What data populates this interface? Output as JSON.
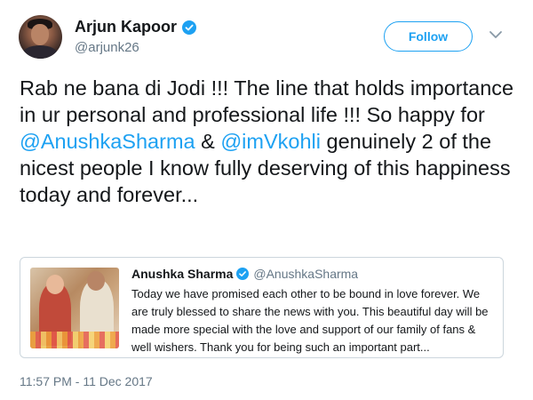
{
  "author": {
    "name": "Arjun Kapoor",
    "handle": "@arjunk26",
    "verified": true
  },
  "follow_button_label": "Follow",
  "tweet_text": {
    "part1": "Rab ne bana di Jodi !!! The line that holds importance in ur personal and professional life !!! So happy for ",
    "mention1": "@AnushkaSharma",
    "part2": " & ",
    "mention2": "@imVkohli",
    "part3": " genuinely 2 of the nicest people I know fully deserving of this happiness today and forever..."
  },
  "quoted_tweet": {
    "name": "Anushka Sharma",
    "handle": "@AnushkaSharma",
    "verified": true,
    "text": "Today we have promised each other to be bound in love forever. We are truly blessed to share the news with you. This beautiful day will be made more special with the love and support of our family of fans & well wishers. Thank you for being such an important part..."
  },
  "timestamp": "11:57 PM - 11 Dec 2017",
  "colors": {
    "accent": "#1da1f2",
    "text": "#14171a",
    "muted": "#657786",
    "border": "#ccd6dd"
  },
  "icons": {
    "verified": "verified-badge-icon",
    "menu": "chevron-down-icon"
  }
}
